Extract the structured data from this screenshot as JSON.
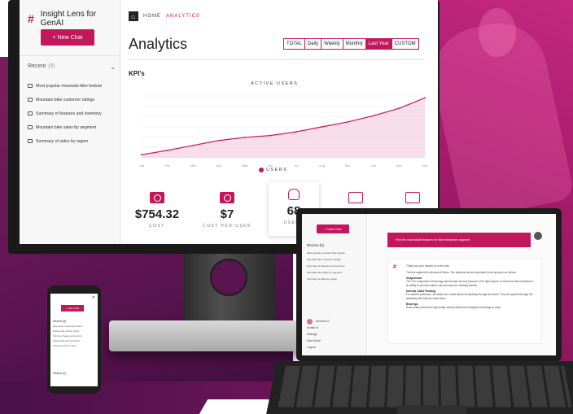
{
  "app": {
    "name": "Insight Lens for GenAI",
    "new_chat_label": "+ New Chat"
  },
  "sidebar": {
    "recent_label": "Recent",
    "recent_count": "(5)",
    "items": [
      "Most popular mountain bike feature",
      "Mountain bike customer ratings",
      "Summary of features and inventory",
      "Mountain bike sales by segment",
      "Summary of sales by region"
    ]
  },
  "breadcrumb": {
    "home": "HOME",
    "current": "ANALYTICS"
  },
  "page": {
    "title": "Analytics",
    "kpi_heading": "KPI's"
  },
  "range_tabs": [
    {
      "label": "TOTAL",
      "active": false
    },
    {
      "label": "Daily",
      "active": false
    },
    {
      "label": "Weekly",
      "active": false
    },
    {
      "label": "Monthly",
      "active": false
    },
    {
      "label": "Last Year",
      "active": true
    },
    {
      "label": "CUSTOM",
      "active": false
    }
  ],
  "chart_data": {
    "type": "area",
    "title": "ACTIVE USERS",
    "categories": [
      "Jan",
      "Feb",
      "Mar",
      "Apr",
      "May",
      "Jun",
      "Jul",
      "Aug",
      "Sep",
      "Oct",
      "Nov",
      "Dec"
    ],
    "series": [
      {
        "name": "USERS",
        "values": [
          5,
          12,
          20,
          28,
          33,
          36,
          42,
          50,
          58,
          68,
          80,
          97
        ]
      }
    ],
    "ylim": [
      0,
      100
    ],
    "grid": true,
    "legend_position": "bottom",
    "colors": {
      "line": "#c2185b",
      "fill": "#f3c6dc"
    }
  },
  "kpis": [
    {
      "value": "$754.32",
      "label": "COST",
      "icon": "money-icon",
      "highlight": false
    },
    {
      "value": "$7",
      "label": "COST PER USER",
      "icon": "money-icon",
      "highlight": false
    },
    {
      "value": "68",
      "label": "USERS",
      "icon": "user-icon",
      "highlight": true
    },
    {
      "value": "",
      "label": "",
      "icon": "chat-icon",
      "highlight": false
    },
    {
      "value": "",
      "label": "",
      "icon": "chat-icon",
      "highlight": false
    }
  ],
  "laptop": {
    "new_chat_label": "+ New Chat",
    "recent_label": "Recent (5)",
    "question": "Find the most valued features for hike enterprises segment",
    "answer_intro": "Thank you your answer is on the way...",
    "answer_lead": "The five segment is Advanced Riders. The features that are important to this group is as follows:",
    "sections": [
      {
        "title": "Suspension",
        "body": "The 'Pro' suspension technology earned was not only because of its high degree of control but also because of its ability to prevent bottom outs and improve climbing traction."
      },
      {
        "title": "Internal Cable Routing",
        "body": "For optimal protection, all cables are routed almost completely through the frame. They are guided through the chainstay with internal cable tubes."
      },
      {
        "title": "Bearings",
        "body": "Extra seals protect the high quality double sealed full compliment bearings to keep."
      }
    ],
    "user_menu": [
      "Amanda G",
      "Invalid in",
      "Settings",
      "Dark Mode",
      "Logout"
    ]
  },
  "phone": {
    "new_chat_label": "+ New Chat",
    "recent_label": "Recent (5)",
    "search_label": "Search (0)"
  },
  "colors": {
    "accent": "#c2185b",
    "brand_dark": "#5a1450"
  }
}
